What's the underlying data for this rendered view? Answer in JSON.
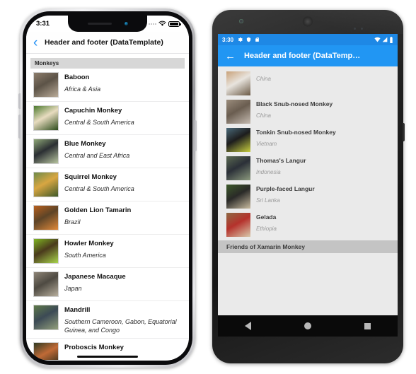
{
  "iphone": {
    "status": {
      "time": "3:31",
      "wifi_icon": "wifi-icon",
      "battery_icon": "battery-icon"
    },
    "navbar": {
      "back_icon": "chevron-left-icon",
      "title": "Header and footer (DataTemplate)"
    },
    "list": {
      "group_header": "Monkeys",
      "rows": [
        {
          "name": "Baboon",
          "location": "Africa & Asia",
          "thumb": "baboon-thumbnail",
          "c1": "#8d7d6c",
          "c2": "#5c5347",
          "c3": "#b9ab99"
        },
        {
          "name": "Capuchin Monkey",
          "location": "Central & South America",
          "thumb": "capuchin-monkey-thumbnail",
          "c1": "#4c7a2e",
          "c2": "#e8dcc0",
          "c3": "#2d4c1c"
        },
        {
          "name": "Blue Monkey",
          "location": "Central and East Africa",
          "thumb": "blue-monkey-thumbnail",
          "c1": "#8fa878",
          "c2": "#2b2f33",
          "c3": "#b7c49f"
        },
        {
          "name": "Squirrel Monkey",
          "location": "Central & South America",
          "thumb": "squirrel-monkey-thumbnail",
          "c1": "#6d8a4a",
          "c2": "#d8a642",
          "c3": "#3f5a2a"
        },
        {
          "name": "Golden Lion Tamarin",
          "location": "Brazil",
          "thumb": "golden-lion-tamarin-thumbnail",
          "c1": "#b8601e",
          "c2": "#5d4427",
          "c3": "#e0893a"
        },
        {
          "name": "Howler Monkey",
          "location": "South America",
          "thumb": "howler-monkey-thumbnail",
          "c1": "#7fb522",
          "c2": "#4a3a1c",
          "c3": "#a8d44b"
        },
        {
          "name": "Japanese Macaque",
          "location": "Japan",
          "thumb": "japanese-macaque-thumbnail",
          "c1": "#8e8577",
          "c2": "#4e4a42",
          "c3": "#b7ae9d"
        },
        {
          "name": "Mandrill",
          "location": "Southern Cameroon, Gabon, Equatorial Guinea, and Congo",
          "thumb": "mandrill-thumbnail",
          "c1": "#5f7a4a",
          "c2": "#3c4a55",
          "c3": "#93a07c"
        },
        {
          "name": "Proboscis Monkey",
          "location": "",
          "thumb": "proboscis-monkey-thumbnail",
          "c1": "#2f3a22",
          "c2": "#c06a36",
          "c3": "#1e2617"
        }
      ]
    },
    "home_indicator": "home-indicator"
  },
  "android": {
    "status": {
      "time": "3:30",
      "icons_left": [
        "gear-icon",
        "shield-icon",
        "sd-card-icon"
      ],
      "icons_right": [
        "wifi-icon",
        "signal-icon",
        "battery-icon"
      ]
    },
    "appbar": {
      "back_icon": "arrow-left-icon",
      "title": "Header and footer (DataTemp…"
    },
    "list": {
      "rows": [
        {
          "name": "",
          "location": "China",
          "thumb": "golden-snub-nosed-monkey-thumbnail",
          "c1": "#c9a27a",
          "c2": "#e8e4de",
          "c3": "#6b5a46"
        },
        {
          "name": "Black Snub-nosed Monkey",
          "location": "China",
          "thumb": "black-snub-nosed-monkey-thumbnail",
          "c1": "#9a8c7c",
          "c2": "#6a5d50",
          "c3": "#c4bab0"
        },
        {
          "name": "Tonkin Snub-nosed Monkey",
          "location": "Vietnam",
          "thumb": "tonkin-snub-nosed-monkey-thumbnail",
          "c1": "#4a6a7a",
          "c2": "#1d1d1d",
          "c3": "#c8cf3f"
        },
        {
          "name": "Thomas's Langur",
          "location": "Indonesia",
          "thumb": "thomass-langur-thumbnail",
          "c1": "#5b6a52",
          "c2": "#2b3038",
          "c3": "#8c9a7e"
        },
        {
          "name": "Purple-faced Langur",
          "location": "Sri Lanka",
          "thumb": "purple-faced-langur-thumbnail",
          "c1": "#3d5a2a",
          "c2": "#2a2a28",
          "c3": "#c9bca0"
        },
        {
          "name": "Gelada",
          "location": "Ethiopia",
          "thumb": "gelada-thumbnail",
          "c1": "#8e6a44",
          "c2": "#b5322c",
          "c3": "#d8c9ac"
        }
      ],
      "footer": "Friends of Xamarin Monkey"
    },
    "navbar": {
      "back_icon": "nav-back-triangle-icon",
      "home_icon": "nav-home-circle-icon",
      "recents_icon": "nav-recents-square-icon"
    }
  },
  "colors": {
    "ios_accent": "#1b8cf5",
    "android_primary": "#2196f3",
    "android_status": "#1e88e5",
    "android_bg": "#eaeaea",
    "group_header_bg": "#d7d7d7",
    "footer_bg": "#c4c4c4"
  }
}
